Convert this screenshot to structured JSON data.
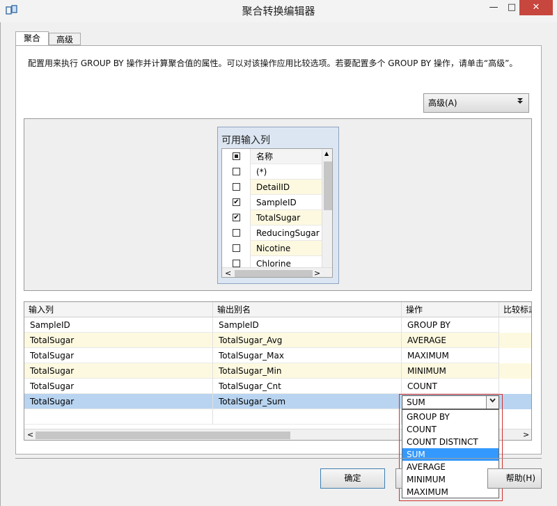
{
  "window": {
    "title": "聚合转换编辑器",
    "minimize": "—",
    "maximize": "□",
    "close": "✕"
  },
  "tabs": [
    {
      "label": "聚合",
      "active": true
    },
    {
      "label": "高级",
      "active": false
    }
  ],
  "description": "配置用来执行 GROUP BY 操作并计算聚合值的属性。可以对该操作应用比较选项。若要配置多个 GROUP BY 操作，请单击“高级”。",
  "advanced_button": {
    "label": "高级(A)",
    "icon": "double-chevron-down-icon"
  },
  "available_inputs": {
    "title": "可用输入列",
    "header": "名称",
    "rows": [
      {
        "name": "(*)",
        "checked": false
      },
      {
        "name": "DetailID",
        "checked": false
      },
      {
        "name": "SampleID",
        "checked": true
      },
      {
        "name": "TotalSugar",
        "checked": true
      },
      {
        "name": "ReducingSugar",
        "checked": false
      },
      {
        "name": "Nicotine",
        "checked": false
      },
      {
        "name": "Chlorine",
        "checked": false
      }
    ],
    "scroll_left": "<",
    "scroll_right": ">"
  },
  "grid": {
    "headers": [
      "输入列",
      "输出别名",
      "操作",
      "比较标志"
    ],
    "rows": [
      {
        "input": "SampleID",
        "alias": "SampleID",
        "operation": "GROUP BY"
      },
      {
        "input": "TotalSugar",
        "alias": "TotalSugar_Avg",
        "operation": "AVERAGE"
      },
      {
        "input": "TotalSugar",
        "alias": "TotalSugar_Max",
        "operation": "MAXIMUM"
      },
      {
        "input": "TotalSugar",
        "alias": "TotalSugar_Min",
        "operation": "MINIMUM"
      },
      {
        "input": "TotalSugar",
        "alias": "TotalSugar_Cnt",
        "operation": "COUNT"
      },
      {
        "input": "TotalSugar",
        "alias": "TotalSugar_Sum",
        "operation": "SUM"
      }
    ],
    "scroll_left": "<",
    "scroll_right": ">"
  },
  "operation_combo": {
    "value": "SUM",
    "options": [
      "GROUP BY",
      "COUNT",
      "COUNT DISTINCT",
      "SUM",
      "AVERAGE",
      "MINIMUM",
      "MAXIMUM"
    ],
    "selected_index": 3
  },
  "buttons": {
    "ok": "确定",
    "help": "帮助(H)"
  }
}
